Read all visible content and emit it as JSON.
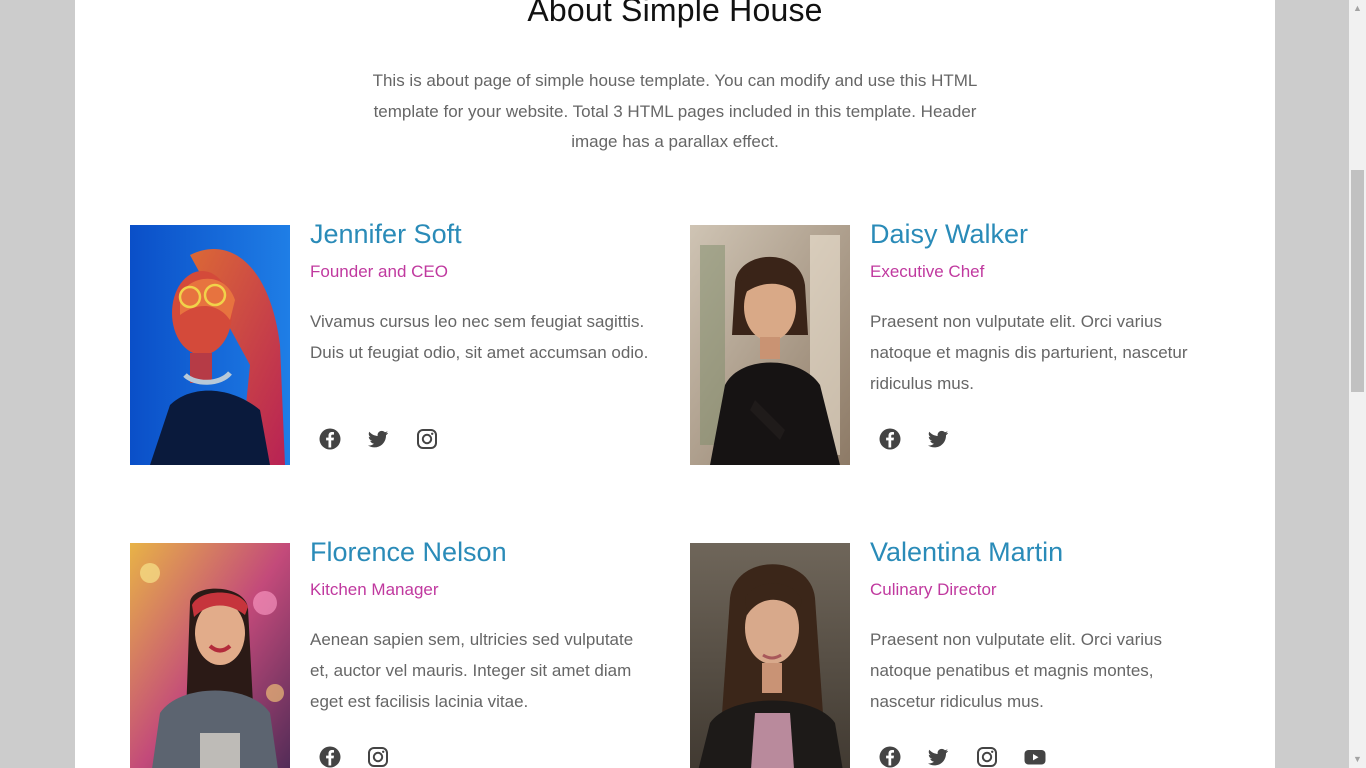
{
  "page": {
    "title": "About Simple House",
    "intro": "This is about page of simple house template. You can modify and use this HTML template for your website. Total 3 HTML pages included in this template. Header image has a parallax effect."
  },
  "team": [
    {
      "name": "Jennifer Soft",
      "role": "Founder and CEO",
      "bio": "Vivamus cursus leo nec sem feugiat sagittis. Duis ut feugiat odio, sit amet accumsan odio.",
      "social": [
        "facebook-icon",
        "twitter-icon",
        "instagram-icon"
      ]
    },
    {
      "name": "Daisy Walker",
      "role": "Executive Chef",
      "bio": "Praesent non vulputate elit. Orci varius natoque et magnis dis parturient, nascetur ridiculus mus.",
      "social": [
        "facebook-icon",
        "twitter-icon"
      ]
    },
    {
      "name": "Florence Nelson",
      "role": "Kitchen Manager",
      "bio": "Aenean sapien sem, ultricies sed vulputate et, auctor vel mauris. Integer sit amet diam eget est facilisis lacinia vitae.",
      "social": [
        "facebook-icon",
        "instagram-icon"
      ]
    },
    {
      "name": "Valentina Martin",
      "role": "Culinary Director",
      "bio": "Praesent non vulputate elit. Orci varius natoque penatibus et magnis montes, nascetur ridiculus mus.",
      "social": [
        "facebook-icon",
        "twitter-icon",
        "instagram-icon",
        "youtube-icon"
      ]
    }
  ],
  "colors": {
    "name": "#2a8bb8",
    "role": "#c0399f",
    "text": "#666666",
    "icon": "#444444",
    "backdrop": "#cccccc"
  }
}
